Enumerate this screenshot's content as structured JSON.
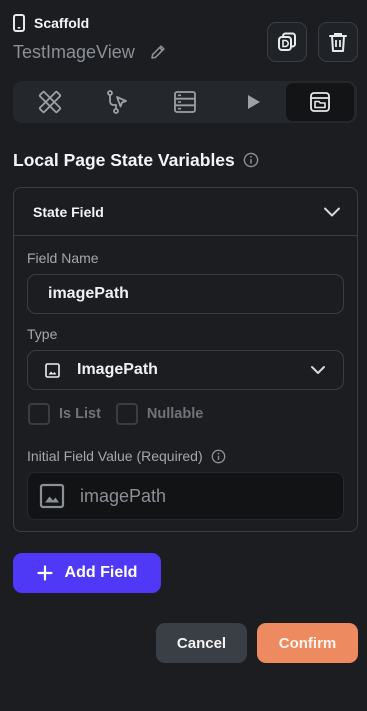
{
  "header": {
    "widget_type": "Scaffold",
    "widget_name": "TestImageView"
  },
  "tabs": [
    {
      "icon": "ruler-pencil-icon",
      "active": false
    },
    {
      "icon": "flow-select-icon",
      "active": false
    },
    {
      "icon": "database-icon",
      "active": false
    },
    {
      "icon": "play-icon",
      "active": false
    },
    {
      "icon": "folder-window-icon",
      "active": true
    }
  ],
  "section": {
    "title": "Local Page State Variables"
  },
  "state_field": {
    "title": "State Field",
    "field_name_label": "Field Name",
    "field_name_value": "imagePath",
    "type_label": "Type",
    "type_value": "ImagePath",
    "is_list_label": "Is List",
    "nullable_label": "Nullable",
    "initial_value_label": "Initial Field Value (Required)",
    "initial_value": "imagePath"
  },
  "actions": {
    "add_field": "Add Field",
    "cancel": "Cancel",
    "confirm": "Confirm"
  },
  "colors": {
    "background": "#1b1d20",
    "accent": "#4f39f6",
    "confirm": "#ee8a60",
    "secondary_button": "#3a3e45"
  }
}
